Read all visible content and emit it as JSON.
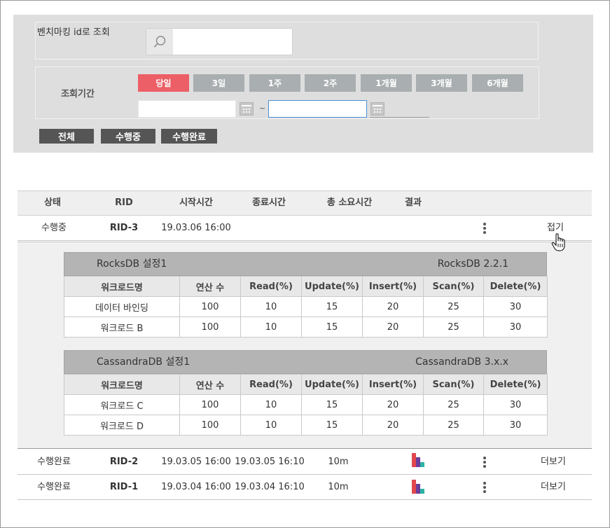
{
  "search": {
    "label": "벤치마킹 id로 조회",
    "input_value": "",
    "input_placeholder": ""
  },
  "period": {
    "label": "조회기간",
    "buttons": [
      "당일",
      "3일",
      "1주",
      "2주",
      "1개월",
      "3개월",
      "6개월"
    ],
    "active_index": 0,
    "date_from": "",
    "date_to": "",
    "separator": "~"
  },
  "status_filter": {
    "buttons": [
      "전체",
      "수행중",
      "수행완료"
    ]
  },
  "table": {
    "headers": {
      "status": "상태",
      "rid": "RID",
      "start": "시작시간",
      "end": "종료시간",
      "duration": "총 소요시간",
      "result": "결과"
    },
    "rows": [
      {
        "status": "수행중",
        "rid": "RID-3",
        "start": "19.03.06 16:00",
        "end": "",
        "duration": "",
        "action": "접기",
        "has_chart": false
      },
      {
        "status": "수행완료",
        "rid": "RID-2",
        "start": "19.03.05 16:00",
        "end": "19.03.05 16:10",
        "duration": "10m",
        "action": "더보기",
        "has_chart": true
      },
      {
        "status": "수행완료",
        "rid": "RID-1",
        "start": "19.03.04 16:00",
        "end": "19.03.04 16:10",
        "duration": "10m",
        "action": "더보기",
        "has_chart": true
      }
    ]
  },
  "detail": {
    "columns": [
      "워크로드명",
      "연산 수",
      "Read(%)",
      "Update(%)",
      "Insert(%)",
      "Scan(%)",
      "Delete(%)"
    ],
    "configs": [
      {
        "name": "RocksDB 설정1",
        "version": "RocksDB  2.2.1",
        "rows": [
          [
            "데이터 바인딩",
            "100",
            "10",
            "15",
            "20",
            "25",
            "30"
          ],
          [
            "워크로드 B",
            "100",
            "10",
            "15",
            "20",
            "25",
            "30"
          ]
        ]
      },
      {
        "name": "CassandraDB 설정1",
        "version": "CassandraDB  3.x.x",
        "rows": [
          [
            "워크로드 C",
            "100",
            "10",
            "15",
            "20",
            "25",
            "30"
          ],
          [
            "워크로드 D",
            "100",
            "10",
            "15",
            "20",
            "25",
            "30"
          ]
        ]
      }
    ]
  },
  "colors": {
    "active_period": "#ec5f66",
    "inactive_period": "#a9aeb0",
    "status_button": "#555555",
    "bar_red": "#e2474c",
    "bar_purple": "#6a3d9a",
    "bar_teal": "#2bb3a3"
  },
  "icons": {
    "search": "search-icon",
    "calendar": "calendar-icon",
    "more": "more-vertical-icon",
    "result_chart": "bar-chart-icon",
    "cursor": "hand-pointer-icon"
  }
}
